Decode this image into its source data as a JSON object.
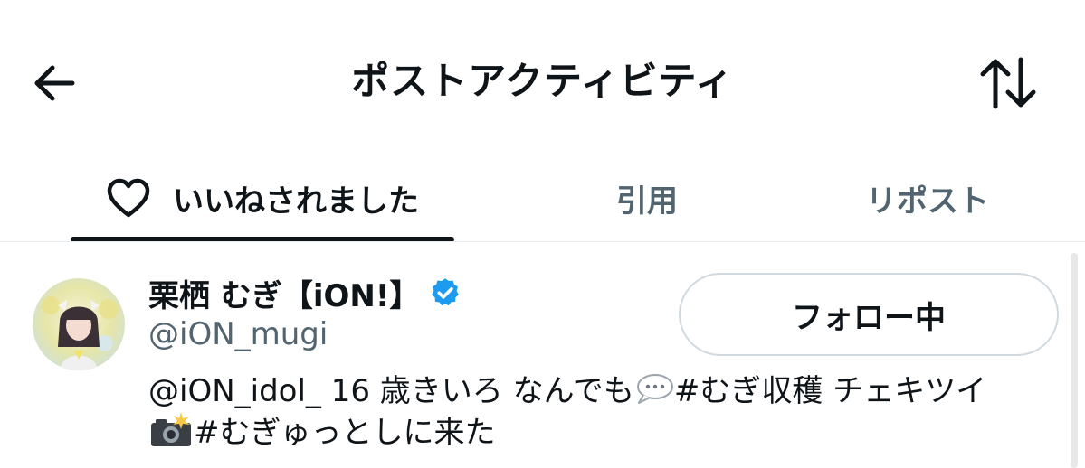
{
  "header": {
    "title": "ポストアクティビティ",
    "back_icon": "arrow-left-icon",
    "sort_icon": "sort-arrows-icon"
  },
  "tabs": [
    {
      "label": "いいねされました",
      "icon": "heart-icon",
      "active": true
    },
    {
      "label": "引用",
      "active": false
    },
    {
      "label": "リポスト",
      "active": false
    }
  ],
  "user": {
    "display_name": "栗栖 むぎ【iON!】",
    "verified": true,
    "verified_color": "#1d9bf0",
    "handle": "@iON_mugi",
    "follow_label": "フォロー中",
    "bio": {
      "mention": "@iON_idol_",
      "text1": " 16 歳きいろ なんでも",
      "speech_emoji": "speech-bubble-icon",
      "hashtag1": "#むぎ収穫",
      "text2": " チェキツイ",
      "camera_emoji": "camera-flash-icon",
      "hashtag2": "#むぎゅっとしに来た"
    }
  },
  "colors": {
    "text": "#0f1419",
    "secondary": "#536471",
    "border": "#cfd9de"
  }
}
